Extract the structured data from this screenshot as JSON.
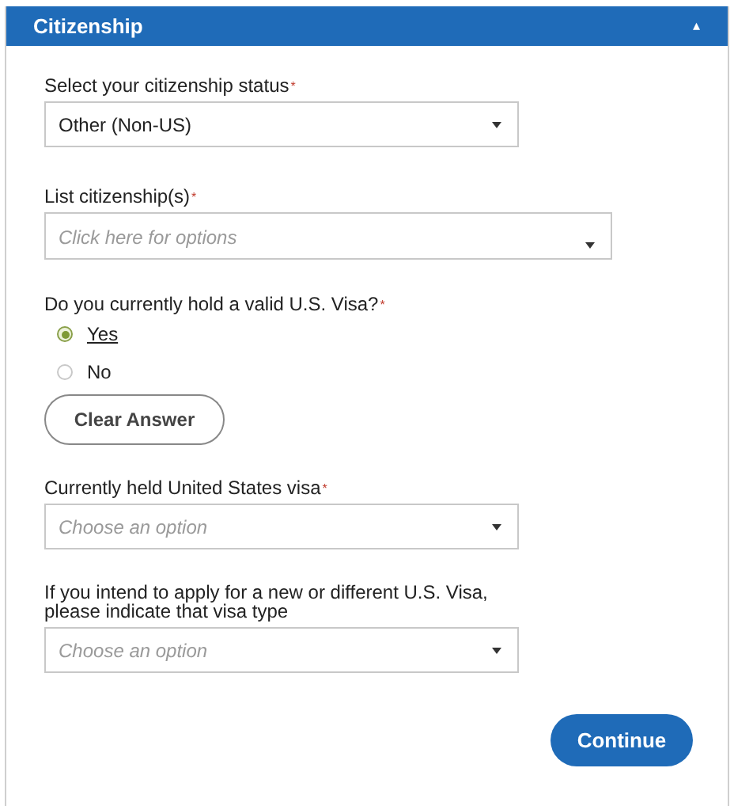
{
  "panel": {
    "title": "Citizenship",
    "collapse_glyph": "▴"
  },
  "fields": [
    {
      "kind": "select",
      "label": "Select your citizenship status",
      "required_mark": "*",
      "value": "Other (Non-US)"
    },
    {
      "kind": "multiselect",
      "label": "List citizenship(s)",
      "required_mark": "*",
      "placeholder": "Click here for options"
    },
    {
      "kind": "radio",
      "label": "Do you currently hold a valid U.S. Visa?",
      "required_mark": "*",
      "options": [
        {
          "label": "Yes",
          "selected": true
        },
        {
          "label": "No",
          "selected": false
        }
      ]
    },
    {
      "kind": "button",
      "label": "Clear Answer"
    },
    {
      "kind": "select",
      "label": "Currently held United States visa",
      "required_mark": "*",
      "placeholder": "Choose an option"
    },
    {
      "kind": "select",
      "label": "If you intend to apply for a new or different U.S. Visa, please indicate that visa type",
      "placeholder": "Choose an option"
    }
  ],
  "continue_button": "Continue"
}
